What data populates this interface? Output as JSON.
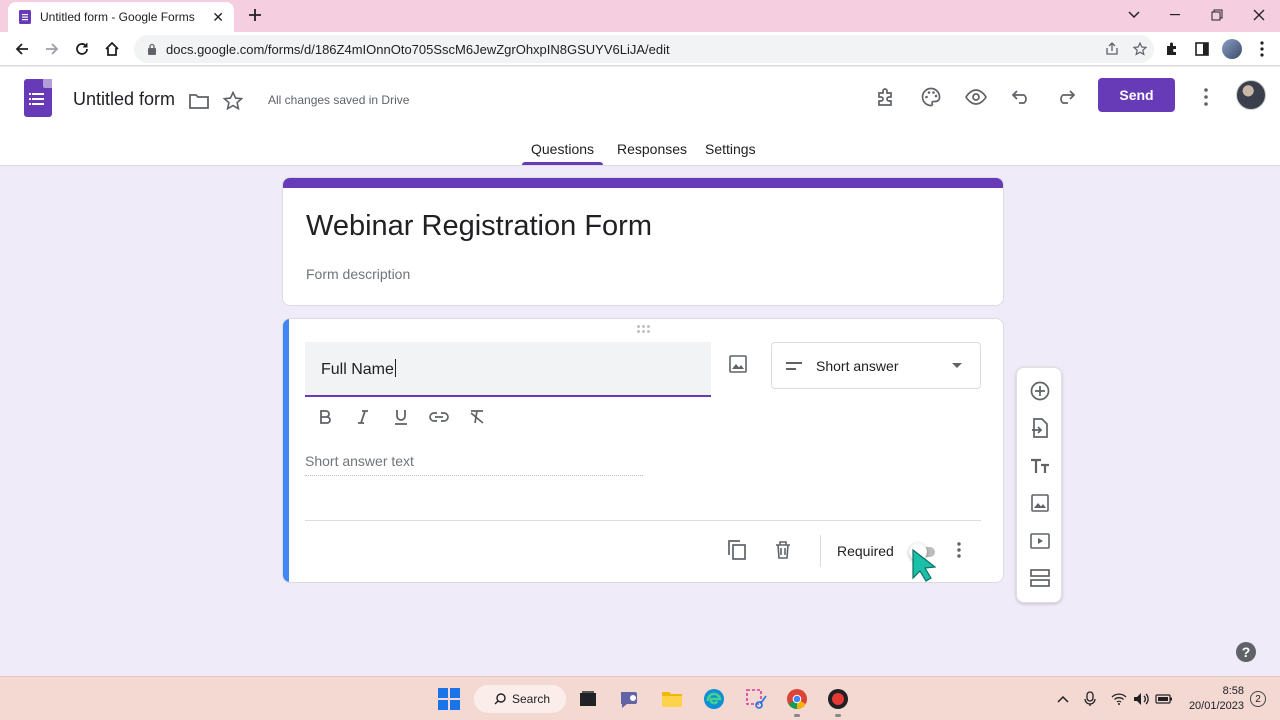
{
  "browser": {
    "tab_title": "Untitled form - Google Forms",
    "url": "docs.google.com/forms/d/186Z4mIOnnOto705SscM6JewZgrOhxpIN8GSUYV6LiJA/edit"
  },
  "header": {
    "doc_title": "Untitled form",
    "saved_status": "All changes saved in Drive",
    "send_label": "Send",
    "tabs": [
      {
        "label": "Questions",
        "active": true
      },
      {
        "label": "Responses",
        "active": false
      },
      {
        "label": "Settings",
        "active": false
      }
    ]
  },
  "form": {
    "title": "Webinar Registration Form",
    "description_placeholder": "Form description"
  },
  "question": {
    "title": "Full Name",
    "type": "Short answer",
    "answer_placeholder": "Short answer text",
    "required_label": "Required",
    "required": false
  },
  "taskbar": {
    "search_label": "Search",
    "time": "8:58",
    "date": "20/01/2023",
    "notification_count": "2"
  },
  "colors": {
    "accent": "#673ab7",
    "question_bar": "#4285f4",
    "page_bg": "#f0ebf8"
  }
}
